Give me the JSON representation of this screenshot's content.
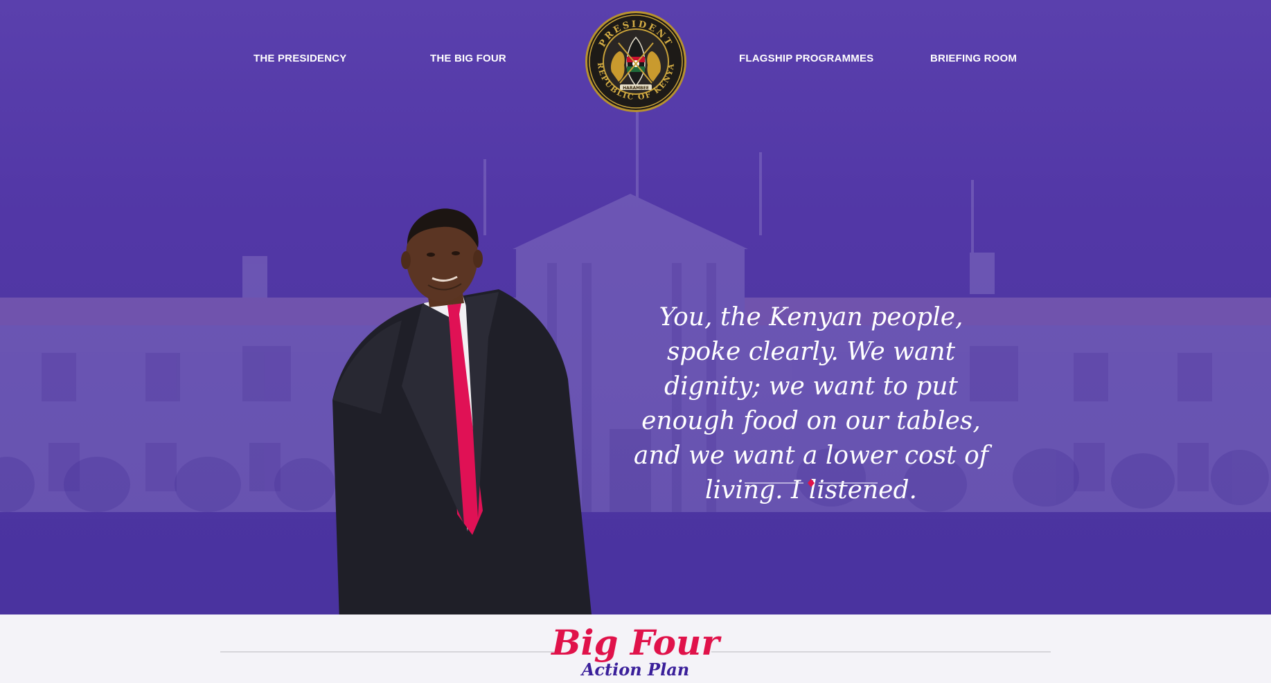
{
  "nav": {
    "items": [
      {
        "label": "THE PRESIDENCY"
      },
      {
        "label": "THE BIG FOUR"
      },
      {
        "label": "FLAGSHIP PROGRAMMES"
      },
      {
        "label": "BRIEFING ROOM"
      }
    ],
    "logo": {
      "icon": "presidential-seal-icon",
      "ring_text_top": "PRESIDENT",
      "ring_text_bottom": "REPUBLIC OF KENYA",
      "motto": "HARAMBEE"
    }
  },
  "hero": {
    "quote": "You, the Kenyan people, spoke clearly. We want dignity; we want to put enough food on our tables, and we want a lower cost of living. I listened."
  },
  "section": {
    "title": "Big Four",
    "subtitle": "Action Plan"
  },
  "colors": {
    "hero_overlay": "#5237a6",
    "accent_red": "#e0124a",
    "subtitle_purple": "#3a1f9a",
    "page_bg": "#f4f3f8"
  }
}
